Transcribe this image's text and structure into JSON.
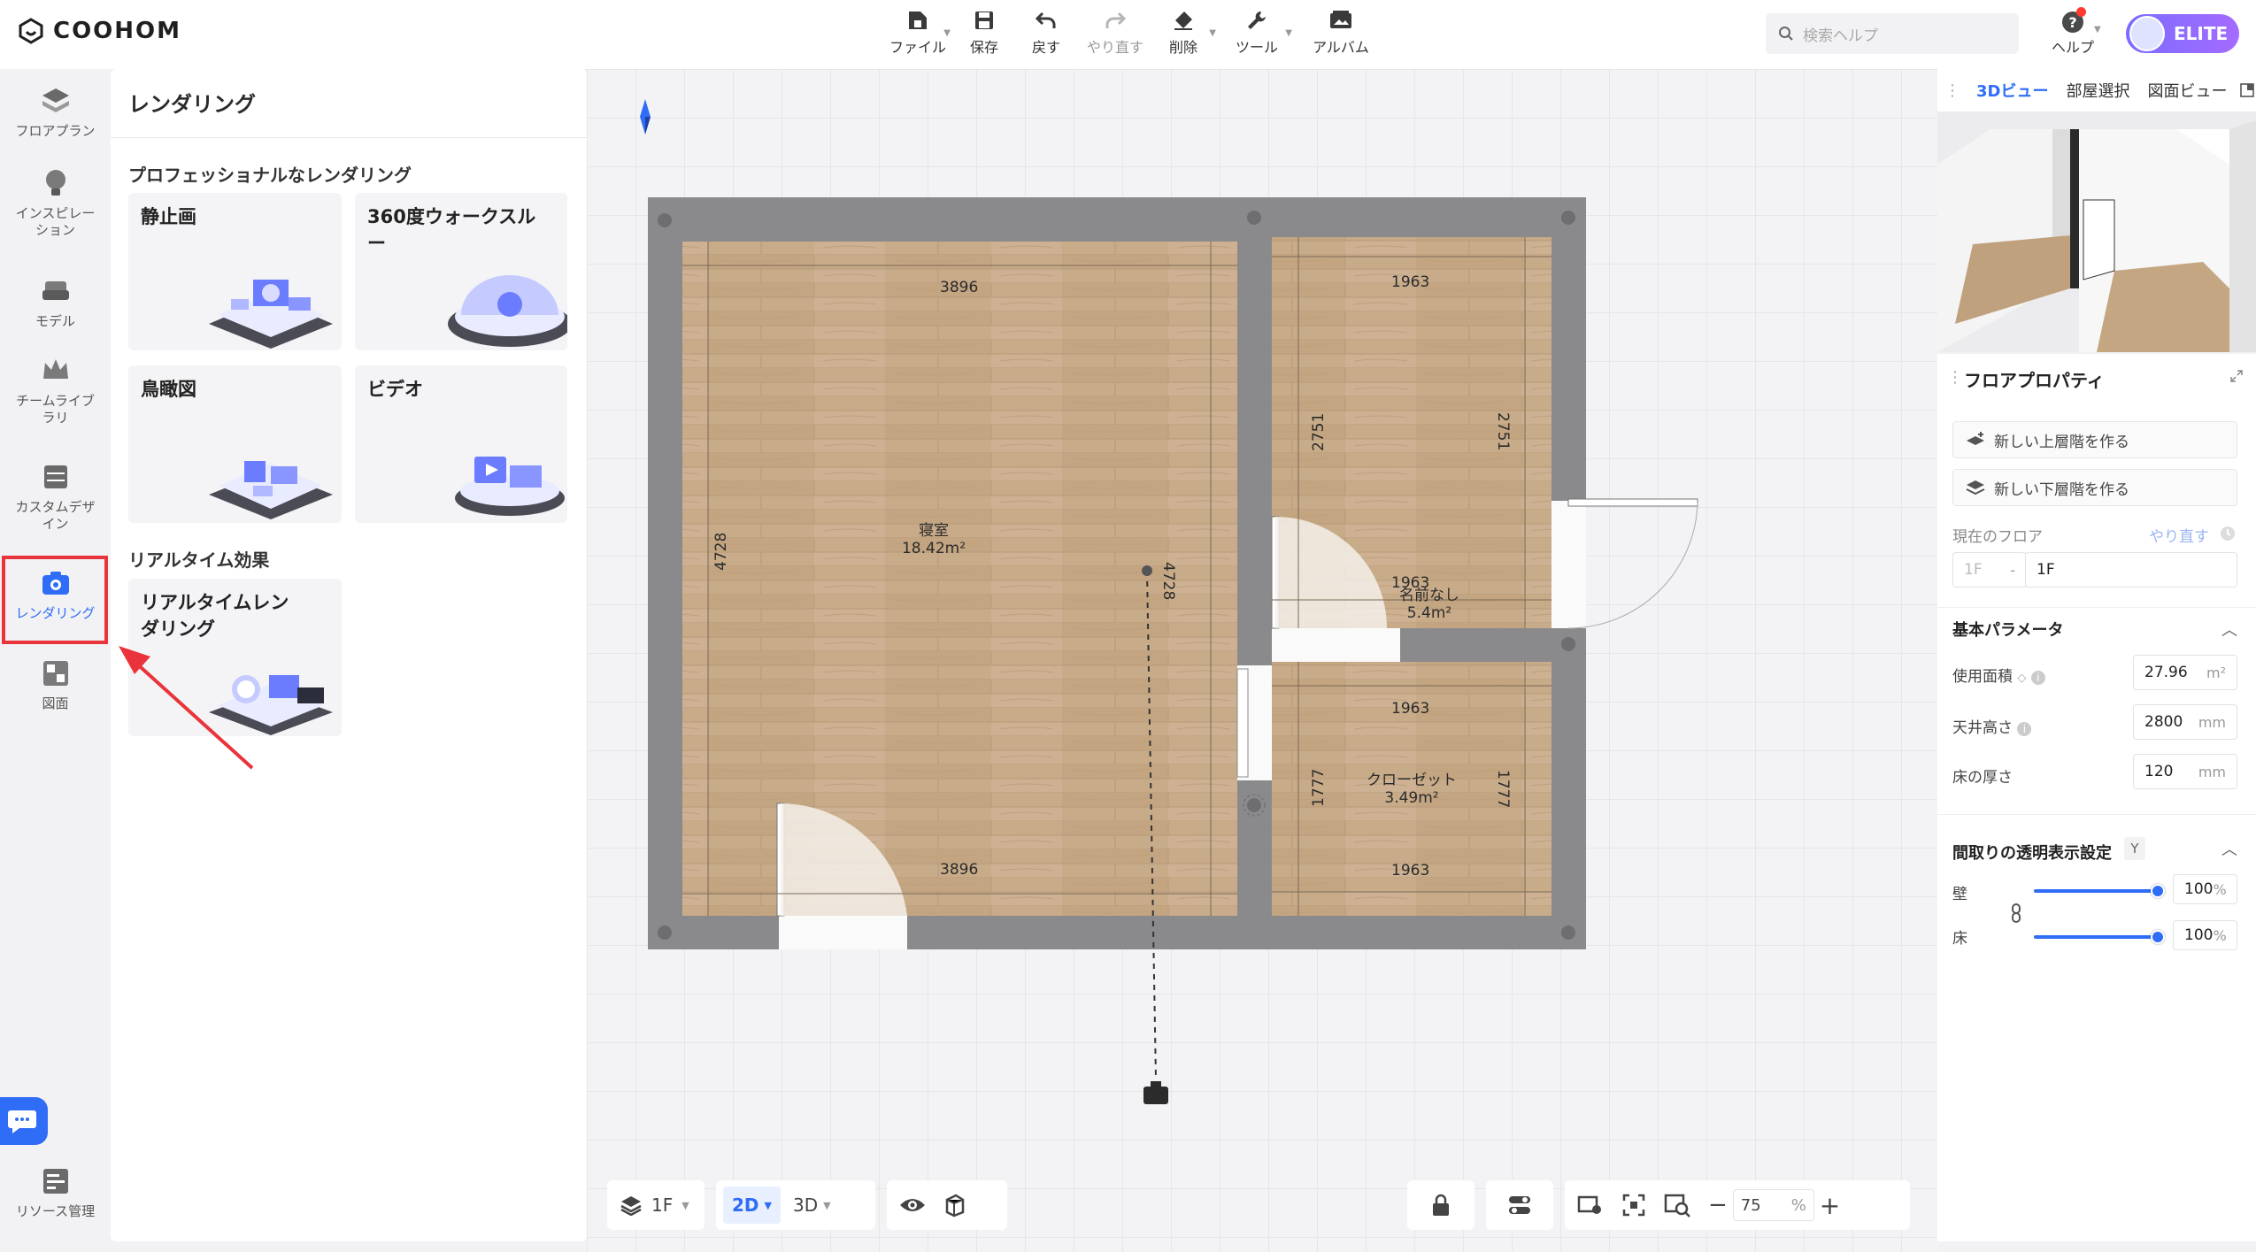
{
  "app": {
    "logo_text": "COOHOM"
  },
  "toolbar": {
    "file": "ファイル",
    "save": "保存",
    "undo": "戻す",
    "redo": "やり直す",
    "delete": "削除",
    "tools": "ツール",
    "album": "アルバム"
  },
  "search": {
    "placeholder": "検索ヘルプ"
  },
  "help": {
    "label": "ヘルプ"
  },
  "user": {
    "badge": "ELITE"
  },
  "leftnav": {
    "floorplan": "フロアプラン",
    "inspiration": "インスピレーション",
    "model": "モデル",
    "team_library": "チームライブラリ",
    "custom_design": "カスタムデザイン",
    "rendering": "レンダリング",
    "drawing": "図面",
    "resources": "リソース管理"
  },
  "panel": {
    "title": "レンダリング",
    "section_pro": "プロフェッショナルなレンダリング",
    "section_realtime": "リアルタイム効果",
    "cards": {
      "still": "静止画",
      "walkthrough": "360度ウォークスルー",
      "aerial": "鳥瞰図",
      "video": "ビデオ",
      "realtime": "リアルタイムレンダリング"
    }
  },
  "plan": {
    "rooms": [
      {
        "name": "寝室",
        "area": "18.42m²"
      },
      {
        "name": "名前なし",
        "area": "5.4m²"
      },
      {
        "name": "クローゼット",
        "area": "3.49m²"
      }
    ],
    "dims": {
      "bed_top": "3896",
      "bed_bottom": "3896",
      "bed_left": "4728",
      "bed_right": "4728",
      "room2_top": "1963",
      "room2_bottom": "1963",
      "room2_left": "2751",
      "room2_right": "2751",
      "closet_top": "1963",
      "closet_bottom": "1963",
      "closet_left": "1777",
      "closet_right": "1777"
    }
  },
  "bottom": {
    "floor": "1F",
    "mode_2d": "2D",
    "mode_3d": "3D",
    "zoom_value": "75",
    "zoom_unit": "%"
  },
  "right": {
    "tabs": {
      "view3d": "3Dビュー",
      "room_select": "部屋選択",
      "plan_view": "図面ビュー"
    },
    "floor_props": "フロアプロパティ",
    "new_upper": "新しい上層階を作る",
    "new_lower": "新しい下層階を作る",
    "current_floor": "現在のフロア",
    "redo": "やり直す",
    "floor_prefix": "1F",
    "floor_value": "1F",
    "basic_params": "基本パラメータ",
    "usable_area": "使用面積",
    "usable_area_value": "27.96",
    "usable_area_unit": "m²",
    "ceiling_height": "天井高さ",
    "ceiling_height_value": "2800",
    "ceiling_height_unit": "mm",
    "floor_thickness": "床の厚さ",
    "floor_thickness_value": "120",
    "floor_thickness_unit": "mm",
    "transparency": "間取りの透明表示設定",
    "transparency_key": "Y",
    "wall": "壁",
    "wall_value": "100",
    "floor": "床",
    "floor_value_pct": "100",
    "pct": "%"
  },
  "colors": {
    "accent": "#2f6df6",
    "highlight": "#e8343a",
    "wall": "#8a8a8c",
    "wood": "#c7ab88"
  }
}
